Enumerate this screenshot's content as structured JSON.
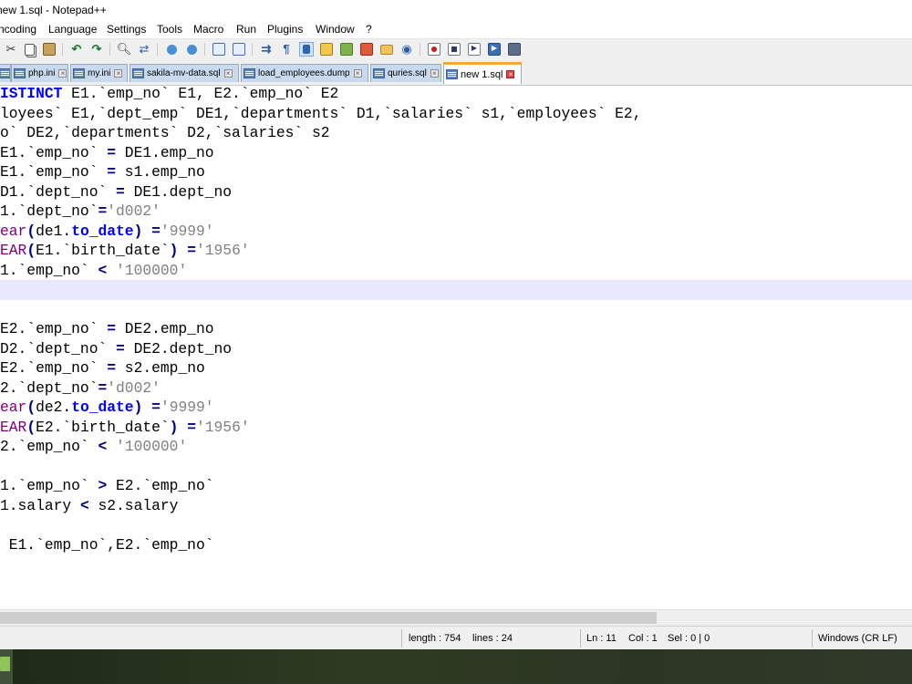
{
  "window": {
    "title": "new 1.sql - Notepad++"
  },
  "menu": [
    "ncoding",
    "Language",
    "Settings",
    "Tools",
    "Macro",
    "Run",
    "Plugins",
    "Window",
    "?"
  ],
  "toolbar_icons": [
    "cut-icon",
    "copy-icon",
    "paste-icon",
    "undo-icon",
    "redo-icon",
    "find-icon",
    "replace-icon",
    "zoom-in-icon",
    "zoom-out-icon",
    "sync-vertical-icon",
    "sync-horizontal-icon",
    "word-wrap-icon",
    "show-all-chars-icon",
    "indent-guide-icon",
    "user-define-lang-icon",
    "doc-map-icon",
    "function-list-icon",
    "folder-workspace-icon",
    "monitoring-icon",
    "record-macro-icon",
    "stop-macro-icon",
    "play-macro-icon",
    "run-macro-multiple-icon",
    "save-macro-icon"
  ],
  "tabs": [
    {
      "label": "",
      "active": false
    },
    {
      "label": "php.ini",
      "active": false
    },
    {
      "label": "my.ini",
      "active": false
    },
    {
      "label": "sakila-mv-data.sql",
      "active": false
    },
    {
      "label": "load_employees.dump",
      "active": false
    },
    {
      "label": "quries.sql",
      "active": false
    },
    {
      "label": "new 1.sql",
      "active": true
    }
  ],
  "code_lines": [
    "ISTINCT E1.`emp_no` E1, E2.`emp_no` E2",
    "loyees` E1,`dept_emp` DE1,`departments` D1,`salaries` s1,`employees` E2,",
    "o` DE2,`departments` D2,`salaries` s2",
    "E1.`emp_no` = DE1.emp_no",
    "E1.`emp_no` = s1.emp_no",
    "D1.`dept_no` = DE1.dept_no",
    "1.`dept_no`='d002'",
    "ear(de1.to_date) ='9999'",
    "EAR(E1.`birth_date`) ='1956'",
    "1.`emp_no` < '100000'",
    "",
    "",
    "E2.`emp_no` = DE2.emp_no",
    "D2.`dept_no` = DE2.dept_no",
    "E2.`emp_no` = s2.emp_no",
    "2.`dept_no`='d002'",
    "ear(de2.to_date) ='9999'",
    "EAR(E2.`birth_date`) ='1956'",
    "2.`emp_no` < '100000'",
    "",
    "1.`emp_no` > E2.`emp_no`",
    "1.salary < s2.salary",
    "",
    " E1.`emp_no`,E2.`emp_no`"
  ],
  "status": {
    "length": "length : 754",
    "lines": "lines : 24",
    "ln": "Ln : 11",
    "col": "Col : 1",
    "sel": "Sel : 0 | 0",
    "eol": "Windows (CR LF)"
  },
  "current_line": 11,
  "horizontal_scroll_fraction": 0.72
}
